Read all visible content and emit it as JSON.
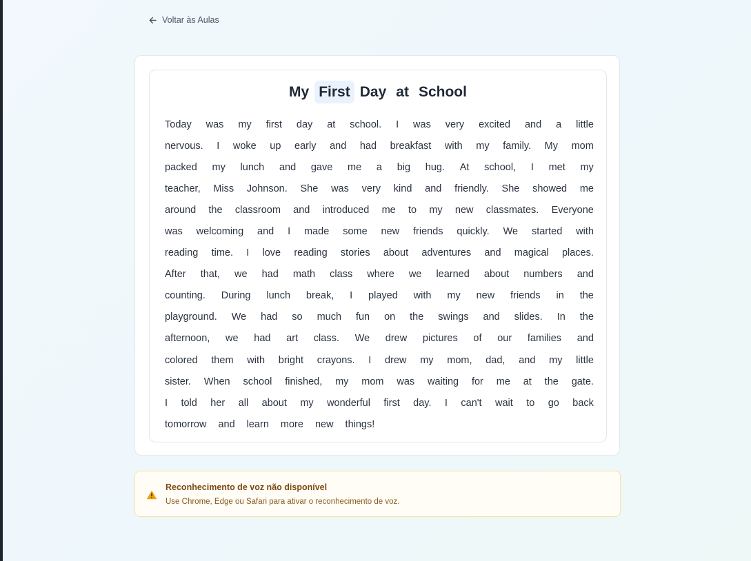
{
  "nav": {
    "back_label": "Voltar às Aulas"
  },
  "lesson": {
    "title_words": [
      "My",
      "First",
      "Day",
      "at",
      "School"
    ],
    "highlighted_word_index": 1,
    "lines": [
      "Today was my first day at school. I was very excited and a little",
      "nervous. I woke up early and had breakfast with my family. My mom",
      "packed my lunch and gave me a big hug. At school, I met my",
      "teacher, Miss Johnson. She was very kind and friendly. She showed me",
      "around the classroom and introduced me to my new classmates. Everyone",
      "was welcoming and I made some new friends quickly. We started with",
      "reading time. I love reading stories about adventures and magical places.",
      "After that, we had math class where we learned about numbers and",
      "counting. During lunch break, I played with my new friends in the",
      "playground. We had so much fun on the swings and slides. In the",
      "afternoon, we had art class. We drew pictures of our families and",
      "colored them with bright crayons. I drew my mom, dad, and my little",
      "sister. When school finished, my mom was waiting for me at the gate.",
      "I told her all about my wonderful first day. I can't wait to go back",
      "tomorrow and learn more new things!"
    ],
    "full_width_lines": [
      0,
      1,
      2,
      3,
      4,
      5,
      6,
      7,
      8,
      9,
      10,
      11,
      12,
      13
    ]
  },
  "warning": {
    "icon": "warning-triangle-icon",
    "title": "Reconhecimento de voz não disponível",
    "description": "Use Chrome, Edge ou Safari para ativar o reconhecimento de voz."
  },
  "colors": {
    "highlight": "#eaf3fd",
    "warning_bg": "#fffdf6",
    "warning_border": "#f7e3a1",
    "warning_icon": "#f0a20a"
  }
}
